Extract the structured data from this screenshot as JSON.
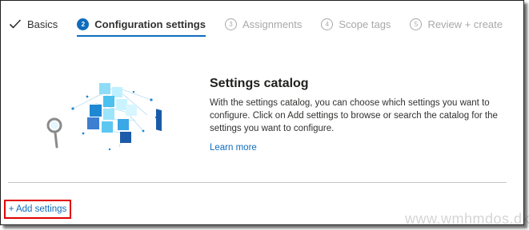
{
  "wizard": {
    "steps": [
      {
        "number": "",
        "label": "Basics",
        "state": "done"
      },
      {
        "number": "2",
        "label": "Configuration settings",
        "state": "active"
      },
      {
        "number": "3",
        "label": "Assignments",
        "state": "pending"
      },
      {
        "number": "4",
        "label": "Scope tags",
        "state": "pending"
      },
      {
        "number": "5",
        "label": "Review + create",
        "state": "pending"
      }
    ]
  },
  "catalog": {
    "title": "Settings catalog",
    "description": "With the settings catalog, you can choose which settings you want to configure. Click on Add settings to browse or search the catalog for the settings you want to configure.",
    "learn_more": "Learn more",
    "illustration_icon": "settings-catalog-illustration"
  },
  "actions": {
    "add_settings": "+ Add settings"
  },
  "watermark": "www.wmhmdos.dk",
  "colors": {
    "accent": "#0f6cbd",
    "highlight": "#e00000",
    "active_step": "#0f6cbd"
  }
}
